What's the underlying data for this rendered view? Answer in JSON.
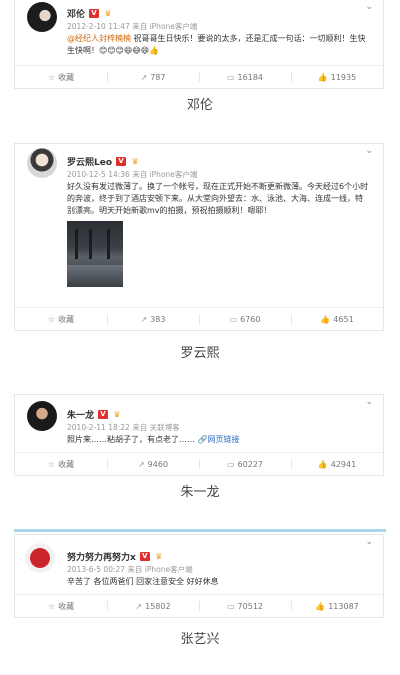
{
  "posts": [
    {
      "user": "邓伦",
      "meta": "2012-2-10 11:47 来自 iPhone客户端",
      "content_mention": "@经纪人封梓楠楠",
      "content": " 祝哥哥生日快乐！要说的太多，还是汇成一句话：一切顺利！生快生快啊！😊😊😊😄😄😄👍",
      "actions": {
        "collect": "收藏",
        "repost": "787",
        "comment": "16184",
        "like": "11935"
      },
      "caption": "邓伦"
    },
    {
      "user": "罗云熙Leo",
      "meta": "2010-12-5 14:36 来自 iPhone客户端",
      "content": "好久没有发过微薄了。换了一个帐号，现在正式开始不断更新微薄。今天经过6个小时的奔波，终于到了酒店安顿下来。从大堂向外望去：水、泳池、大海、连成一线，特别漂亮。明天开始新歌mv的拍摄，预祝拍摄顺利！嗯耶！",
      "actions": {
        "collect": "收藏",
        "repost": "383",
        "comment": "6760",
        "like": "4651"
      },
      "caption": "罗云熙"
    },
    {
      "user": "朱一龙",
      "meta": "2010-2-11 18:22 来自 关联博客",
      "content": "照片来……粘胡子了，有点老了……",
      "content_link": "网页链接",
      "actions": {
        "collect": "收藏",
        "repost": "9460",
        "comment": "60227",
        "like": "42941"
      },
      "caption": "朱一龙"
    },
    {
      "user": "努力努力再努力x",
      "meta": "2013-6-5 00:27 来自 iPhone客户端",
      "content": "辛苦了 各位两爸们 回家注意安全 好好休息",
      "actions": {
        "collect": "收藏",
        "repost": "15802",
        "comment": "70512",
        "like": "113087"
      },
      "caption": "张艺兴"
    }
  ],
  "icons": {
    "collect": "☆",
    "repost": "↗",
    "comment": "▭",
    "like": "👍",
    "more": "⌄"
  },
  "colors": {
    "verified": "#e0302d",
    "mention": "#d06a10",
    "link": "#2c6fbd",
    "separator": "#a7d6e6"
  }
}
